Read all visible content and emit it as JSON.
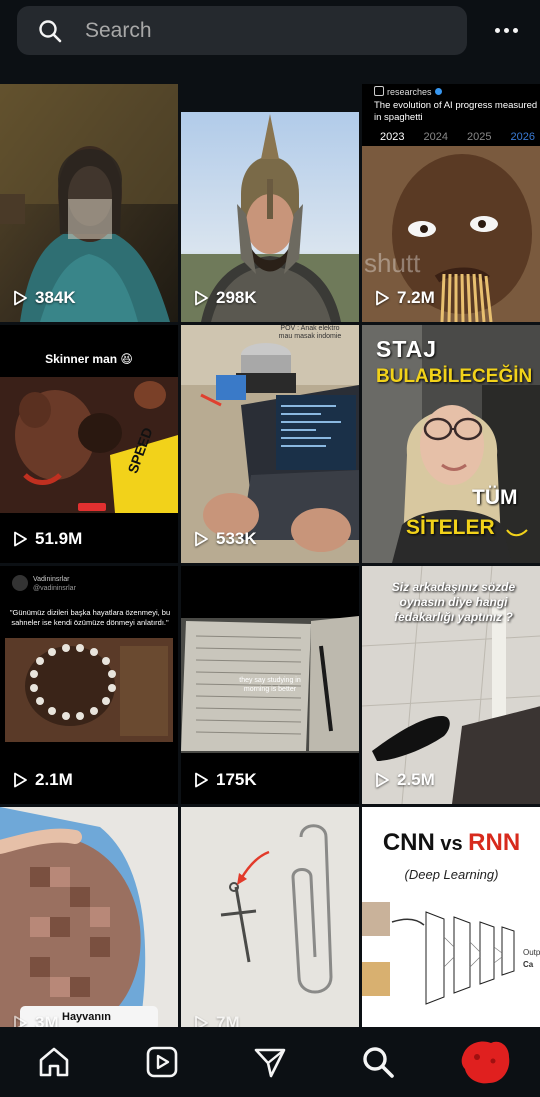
{
  "search": {
    "placeholder": "Search",
    "value": ""
  },
  "tiles": [
    {
      "views": "384K"
    },
    {
      "views": "298K"
    },
    {
      "views": "7.2M",
      "account": "researches",
      "headline": "The evolution of AI progress measured in spaghetti",
      "years": [
        "2023",
        "2024",
        "2025",
        "2026"
      ],
      "watermark": "shutt"
    },
    {
      "views": "51.9M",
      "caption": "Skinner man 😆"
    },
    {
      "views": "533K",
      "overlay_line1": "POV : Anak elektro",
      "overlay_line2": "mau masak indomie"
    },
    {
      "views": "",
      "title_line1": "STAJ",
      "title_line2": "BULABİLECEĞİN",
      "title_line3": "TÜM",
      "title_line4": "SİTELER"
    },
    {
      "views": "2.1M",
      "account_name": "Vadininsrlar",
      "account_handle": "@vadininsrlar",
      "quote": "\"Günümüz dizileri başka hayatlara özenmeyi, bu sahneler ise kendi özümüze dönmeyi anlatırdı.\""
    },
    {
      "views": "175K",
      "overlay": "they say studying in morning is better"
    },
    {
      "views": "2.5M",
      "question": "Siz arkadaşınız sözde oynasın diye hangi fedakarlığı yaptınız ?"
    },
    {
      "views": "3M",
      "label": "Hayvanın"
    },
    {
      "views": "7M"
    },
    {
      "views": "",
      "title_a": "CNN",
      "title_vs": " vs ",
      "title_b": "RNN",
      "subtitle": "(Deep Learning)",
      "output_label": "Outp",
      "output_label2": "Ca"
    }
  ],
  "colors": {
    "background": "#0c1014",
    "search_bg": "#25292e",
    "profile_red": "#e0201f",
    "rnn_red": "#d72a1c"
  }
}
